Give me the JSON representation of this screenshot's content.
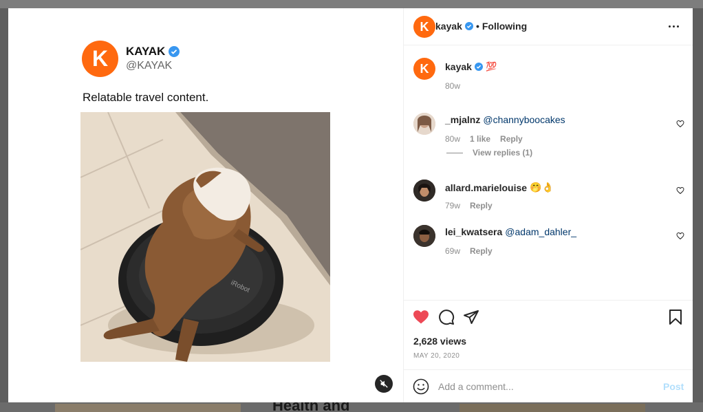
{
  "background": {
    "heading": "Health and"
  },
  "media": {
    "embedded_tweet": {
      "avatar_letter": "K",
      "name": "KAYAK",
      "handle": "@KAYAK",
      "text": "Relatable travel content."
    },
    "video_description": "Bulldog riding a robot vacuum",
    "mute_icon": "muted-speaker-icon"
  },
  "header": {
    "avatar_letter": "K",
    "username": "kayak",
    "separator": "•",
    "follow_status": "Following",
    "more_icon": "more-dots-icon"
  },
  "caption": {
    "avatar_letter": "K",
    "username": "kayak",
    "text": "💯",
    "time": "80w"
  },
  "comments": [
    {
      "username": "_mjalnz",
      "text": "@channyboocakes",
      "time": "80w",
      "likes": "1 like",
      "reply_label": "Reply",
      "view_replies": "View replies (1)"
    },
    {
      "username": "allard.marielouise",
      "text": "🤭👌",
      "time": "79w",
      "reply_label": "Reply"
    },
    {
      "username": "lei_kwatsera",
      "text": "@adam_dahler_",
      "time": "69w",
      "reply_label": "Reply"
    }
  ],
  "actions": {
    "like_icon": "heart-filled-icon",
    "comment_icon": "comment-icon",
    "share_icon": "paper-plane-icon",
    "save_icon": "bookmark-icon",
    "views": "2,628 views",
    "date": "MAY 20, 2020"
  },
  "add_comment": {
    "placeholder": "Add a comment...",
    "post_label": "Post",
    "emoji_icon": "smiley-icon"
  },
  "colors": {
    "brand_orange": "#ff690f",
    "verified_blue": "#3897f0",
    "like_red": "#ed4956",
    "mention_blue": "#00376b",
    "post_disabled": "#b2dffc"
  }
}
